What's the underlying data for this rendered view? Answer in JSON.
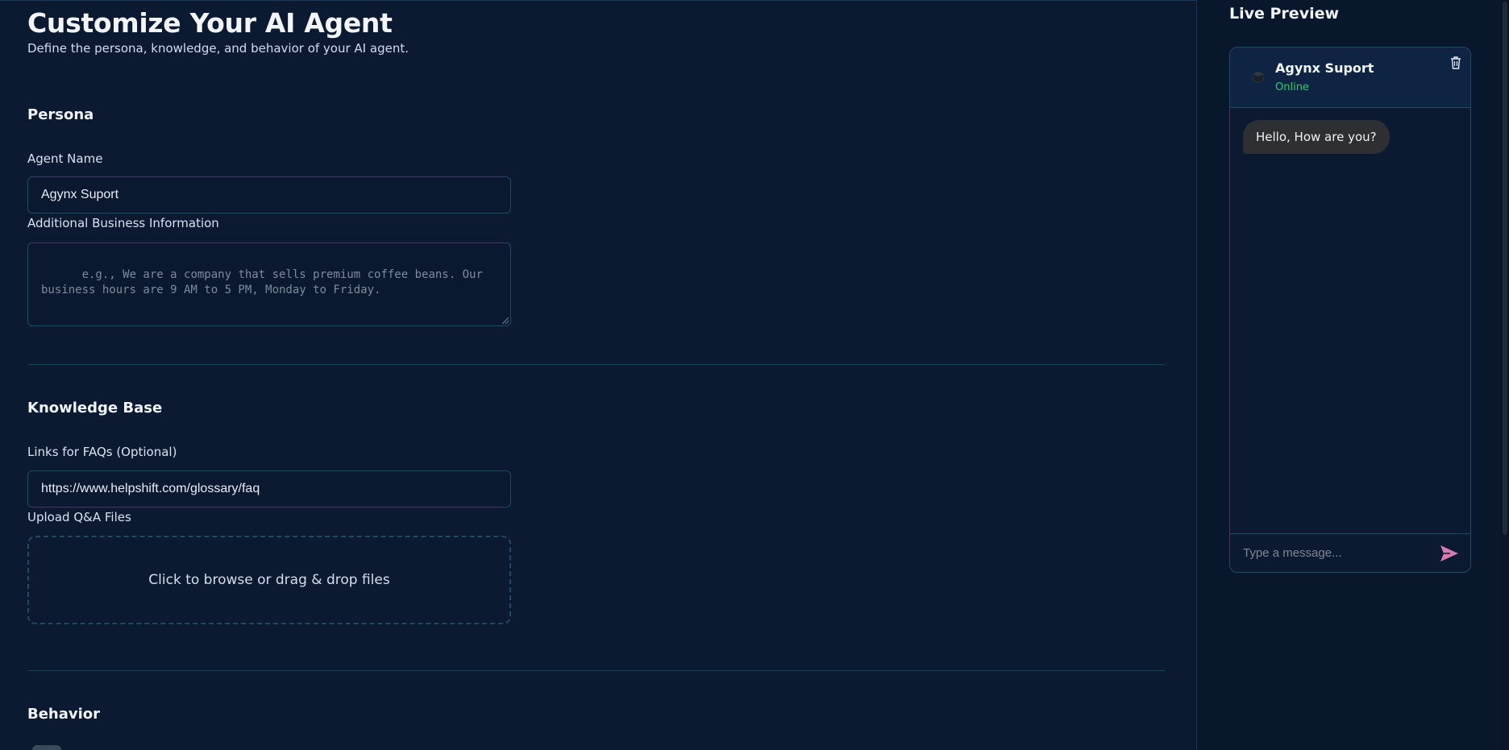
{
  "page": {
    "title": "Customize Your AI Agent",
    "subtitle": "Define the persona, knowledge, and behavior of your AI agent."
  },
  "persona": {
    "section_title": "Persona",
    "agent_name_label": "Agent Name",
    "agent_name_value": "Agynx Suport",
    "business_info_label": "Additional Business Information",
    "business_info_placeholder": "e.g., We are a company that sells premium coffee beans. Our\nbusiness hours are 9 AM to 5 PM, Monday to Friday."
  },
  "knowledge": {
    "section_title": "Knowledge Base",
    "faq_links_label": "Links for FAQs (Optional)",
    "faq_links_value": "https://www.helpshift.com/glossary/faq",
    "upload_label": "Upload Q&A Files",
    "dropzone_text": "Click to browse or drag & drop files"
  },
  "behavior": {
    "section_title": "Behavior"
  },
  "preview": {
    "title": "Live Preview",
    "agent_name": "Agynx Suport",
    "status": "Online",
    "messages": [
      {
        "from": "agent",
        "text": "Hello, How are you?"
      }
    ],
    "input_placeholder": "Type a message...",
    "icons": {
      "avatar": "bot-avatar-icon",
      "clear": "trash-icon",
      "send": "send-icon"
    }
  },
  "colors": {
    "background": "#0b1931",
    "online": "#2ecc71",
    "send_accent": "#d87bb0",
    "bubble": "#2e2f33"
  }
}
